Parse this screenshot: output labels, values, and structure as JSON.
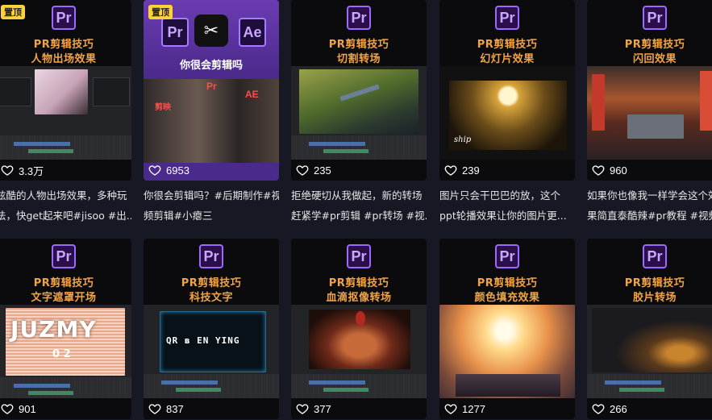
{
  "pin_label": "置顶",
  "cards": [
    {
      "t1": "PR剪辑技巧",
      "t2": "人物出场效果",
      "likes": "3.3万",
      "d1": "炫酷的人物出场效果，多种玩",
      "d2": "法，快get起来吧#jisoo #出..."
    },
    {
      "t1": "PR剪辑技巧",
      "t2": "",
      "likes": "6953",
      "banner": "你很会剪辑吗",
      "d1": "你很会剪辑吗？#后期制作#视",
      "d2": "频剪辑#小瘪三"
    },
    {
      "t1": "PR剪辑技巧",
      "t2": "切割转场",
      "likes": "235",
      "d1": "拒绝硬切从我做起，新的转场",
      "d2": "赶紧学#pr剪辑 #pr转场 #视..."
    },
    {
      "t1": "PR剪辑技巧",
      "t2": "幻灯片效果",
      "likes": "239",
      "d1": "图片只会干巴巴的放，这个",
      "d2": "ppt轮播效果让你的图片更..."
    },
    {
      "t1": "PR剪辑技巧",
      "t2": "闪回效果",
      "likes": "960",
      "d1": "如果你也像我一样学会这个效",
      "d2": "果简直泰酷辣#pr教程 #视频..."
    },
    {
      "t1": "PR剪辑技巧",
      "t2": "文字遮罩开场",
      "likes": "901"
    },
    {
      "t1": "PR剪辑技巧",
      "t2": "科技文字",
      "likes": "837"
    },
    {
      "t1": "PR剪辑技巧",
      "t2": "血滴抠像转场",
      "likes": "377"
    },
    {
      "t1": "PR剪辑技巧",
      "t2": "颜色填充效果",
      "likes": "1277"
    },
    {
      "t1": "PR剪辑技巧",
      "t2": "胶片转场",
      "likes": "266"
    }
  ],
  "card1_icons": {
    "pr": "Pr",
    "ae": "Ae",
    "small_pr": "Pr",
    "small_ae": "AE",
    "tag": "剪映"
  },
  "overlay_text": {
    "jz": "JUZMY",
    "num": "0 2",
    "tech": "QR ʙ EN YING",
    "ship": "ship"
  },
  "colors": {
    "accent": "#f0a44a",
    "pr_purple": "#9b6bff",
    "pin_yellow": "#ffd335",
    "bg": "#161823"
  }
}
